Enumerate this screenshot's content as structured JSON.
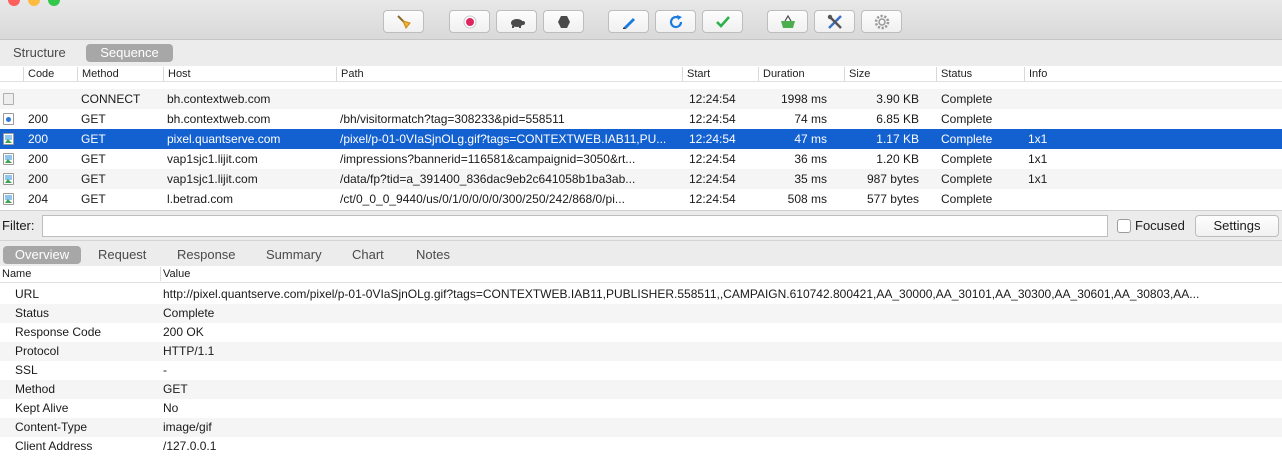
{
  "colors": {
    "selection": "#1360d0",
    "record": "#e0245e",
    "refresh": "#1a7be0",
    "check": "#2bb24c",
    "basket": "#4cae4c"
  },
  "toolbar": {
    "buttons": [
      {
        "name": "clear-broom-icon"
      },
      {
        "name": "record-icon"
      },
      {
        "name": "throttle-turtle-icon"
      },
      {
        "name": "breakpoints-hexagon-icon"
      },
      {
        "name": "compose-pen-icon"
      },
      {
        "name": "repeat-refresh-icon"
      },
      {
        "name": "validate-check-icon"
      },
      {
        "name": "basket-icon"
      },
      {
        "name": "tools-icon"
      },
      {
        "name": "settings-gear-icon"
      }
    ]
  },
  "view_tabs": {
    "structure": "Structure",
    "sequence": "Sequence",
    "selected": "Sequence"
  },
  "table": {
    "headers": {
      "code": "Code",
      "method": "Method",
      "host": "Host",
      "path": "Path",
      "start": "Start",
      "duration": "Duration",
      "size": "Size",
      "status": "Status",
      "info": "Info"
    },
    "rows": [
      {
        "icon": "lock-icon",
        "code": "",
        "method": "CONNECT",
        "host": "bh.contextweb.com",
        "path": "",
        "start": "12:24:54",
        "duration": "1998 ms",
        "size": "3.90 KB",
        "status": "Complete",
        "info": ""
      },
      {
        "icon": "script-icon",
        "code": "200",
        "method": "GET",
        "host": "bh.contextweb.com",
        "path": "/bh/visitormatch?tag=308233&pid=558511",
        "start": "12:24:54",
        "duration": "74 ms",
        "size": "6.85 KB",
        "status": "Complete",
        "info": ""
      },
      {
        "icon": "image-icon",
        "code": "200",
        "method": "GET",
        "host": "pixel.quantserve.com",
        "path": "/pixel/p-01-0VIaSjnOLg.gif?tags=CONTEXTWEB.IAB11,PU...",
        "start": "12:24:54",
        "duration": "47 ms",
        "size": "1.17 KB",
        "status": "Complete",
        "info": "1x1",
        "selected": true
      },
      {
        "icon": "image-icon",
        "code": "200",
        "method": "GET",
        "host": "vap1sjc1.lijit.com",
        "path": "/impressions?bannerid=116581&campaignid=3050&rt...",
        "start": "12:24:54",
        "duration": "36 ms",
        "size": "1.20 KB",
        "status": "Complete",
        "info": "1x1"
      },
      {
        "icon": "image-icon",
        "code": "200",
        "method": "GET",
        "host": "vap1sjc1.lijit.com",
        "path": "/data/fp?tid=a_391400_836dac9eb2c641058b1ba3ab...",
        "start": "12:24:54",
        "duration": "35 ms",
        "size": "987 bytes",
        "status": "Complete",
        "info": "1x1"
      },
      {
        "icon": "image-icon",
        "code": "204",
        "method": "GET",
        "host": "l.betrad.com",
        "path": "/ct/0_0_0_9440/us/0/1/0/0/0/0/300/250/242/868/0/pi...",
        "start": "12:24:54",
        "duration": "508 ms",
        "size": "577 bytes",
        "status": "Complete",
        "info": ""
      }
    ]
  },
  "filter": {
    "label": "Filter:",
    "value": "",
    "focused_label": "Focused",
    "focused_checked": false,
    "settings_label": "Settings"
  },
  "detail_tabs": {
    "items": [
      "Overview",
      "Request",
      "Response",
      "Summary",
      "Chart",
      "Notes"
    ],
    "selected": "Overview"
  },
  "details": {
    "headers": {
      "name": "Name",
      "value": "Value"
    },
    "rows": [
      {
        "name": "URL",
        "value": "http://pixel.quantserve.com/pixel/p-01-0VIaSjnOLg.gif?tags=CONTEXTWEB.IAB11,PUBLISHER.558511,,CAMPAIGN.610742.800421,AA_30000,AA_30101,AA_30300,AA_30601,AA_30803,AA..."
      },
      {
        "name": "Status",
        "value": "Complete"
      },
      {
        "name": "Response Code",
        "value": "200 OK"
      },
      {
        "name": "Protocol",
        "value": "HTTP/1.1"
      },
      {
        "name": "SSL",
        "value": "-"
      },
      {
        "name": "Method",
        "value": "GET"
      },
      {
        "name": "Kept Alive",
        "value": "No"
      },
      {
        "name": "Content-Type",
        "value": "image/gif"
      },
      {
        "name": "Client Address",
        "value": "/127.0.0.1"
      }
    ]
  }
}
